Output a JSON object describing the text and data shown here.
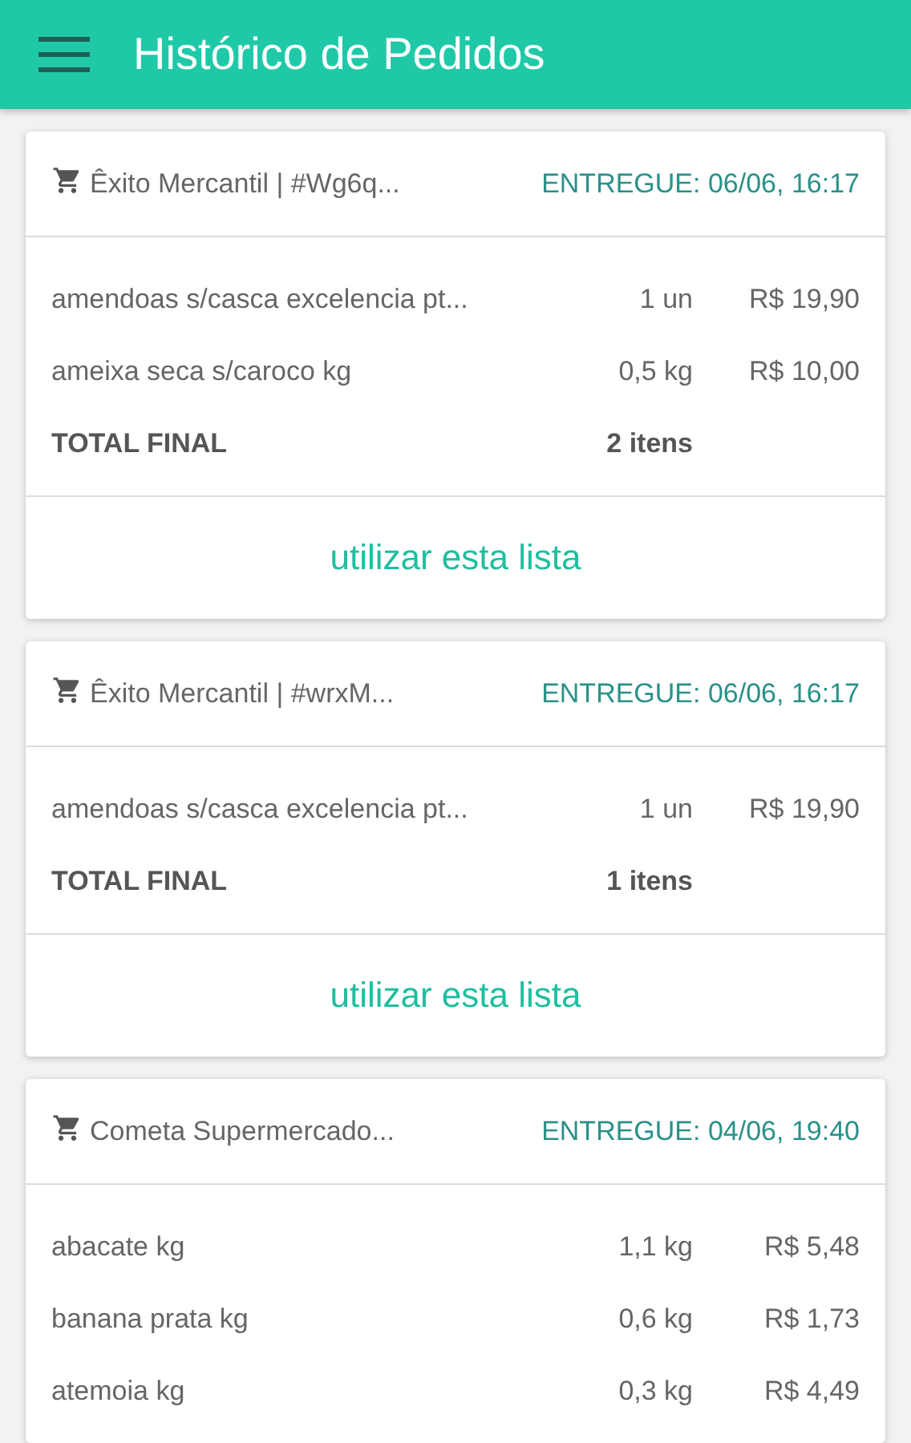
{
  "app_bar": {
    "title": "Histórico de Pedidos"
  },
  "orders": [
    {
      "store": "Êxito Mercantil | #Wg6q...",
      "status": "ENTREGUE: 06/06, 16:17",
      "items": [
        {
          "name": "amendoas s/casca excelencia pt...",
          "quantity": "1 un",
          "price": "R$ 19,90"
        },
        {
          "name": "ameixa seca s/caroco kg",
          "quantity": "0,5 kg",
          "price": "R$ 10,00"
        }
      ],
      "total": {
        "label": "TOTAL FINAL",
        "count": "2 itens"
      },
      "action": "utilizar esta lista"
    },
    {
      "store": "Êxito Mercantil | #wrxM...",
      "status": "ENTREGUE: 06/06, 16:17",
      "items": [
        {
          "name": "amendoas s/casca excelencia pt...",
          "quantity": "1 un",
          "price": "R$ 19,90"
        }
      ],
      "total": {
        "label": "TOTAL FINAL",
        "count": "1 itens"
      },
      "action": "utilizar esta lista"
    },
    {
      "store": "Cometa Supermercado...",
      "status": "ENTREGUE: 04/06, 19:40",
      "items": [
        {
          "name": "abacate kg",
          "quantity": "1,1 kg",
          "price": "R$ 5,48"
        },
        {
          "name": "banana prata kg",
          "quantity": "0,6 kg",
          "price": "R$ 1,73"
        },
        {
          "name": "atemoia kg",
          "quantity": "0,3 kg",
          "price": "R$ 4,49"
        }
      ]
    }
  ]
}
